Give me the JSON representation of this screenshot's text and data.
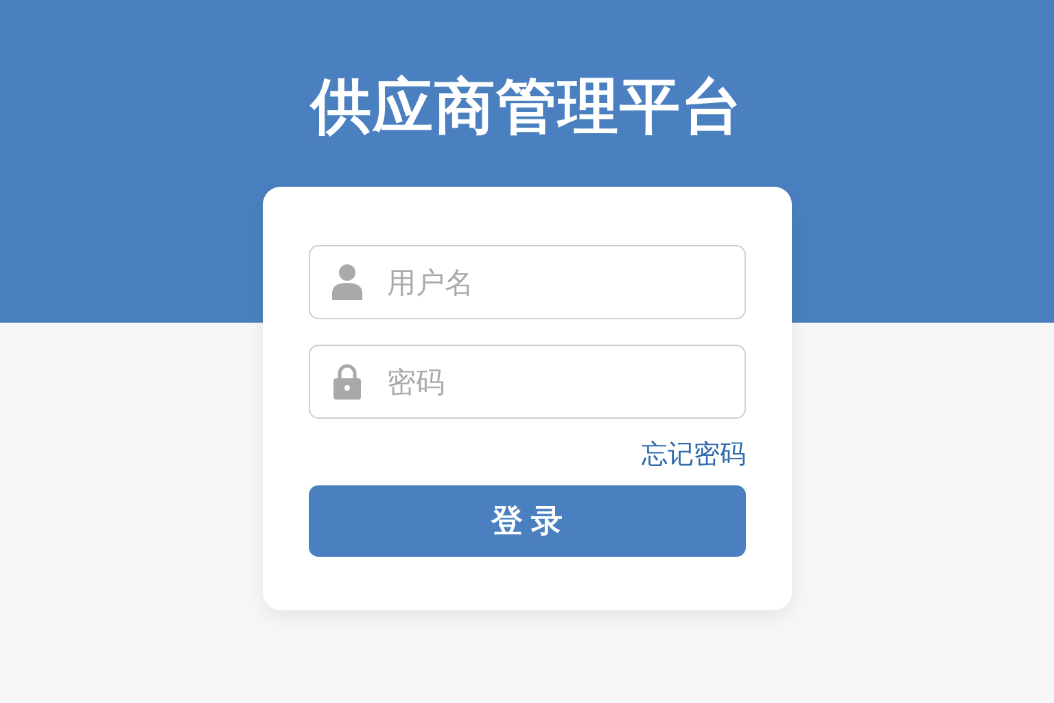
{
  "title": "供应商管理平台",
  "form": {
    "fields": [
      {
        "kind": "user",
        "placeholder": "用户名"
      },
      {
        "kind": "password",
        "placeholder": "密码"
      }
    ],
    "forgot_link": "忘记密码",
    "submit_button": "登录"
  }
}
